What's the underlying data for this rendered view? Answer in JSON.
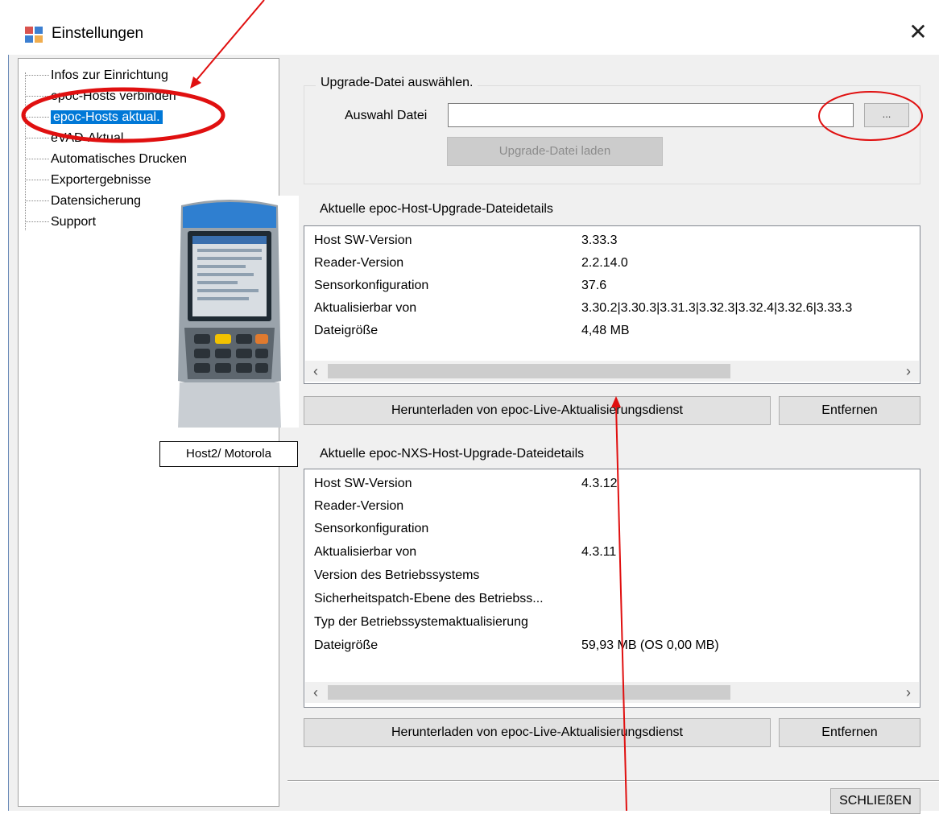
{
  "window": {
    "title": "Einstellungen",
    "close_glyph": "✕"
  },
  "tree": {
    "items": [
      {
        "label": "Infos zur Einrichtung"
      },
      {
        "label": "epoc-Hosts verbinden"
      },
      {
        "label": "epoc-Hosts aktual.",
        "selected": true
      },
      {
        "label": "eVAD-Aktual."
      },
      {
        "label": "Automatisches Drucken"
      },
      {
        "label": "Exportergebnisse"
      },
      {
        "label": "Datensicherung"
      },
      {
        "label": "Support"
      }
    ]
  },
  "upgrade": {
    "group_label": "Upgrade-Datei auswählen.",
    "file_label": "Auswahl Datei",
    "file_value": "",
    "browse_label": "...",
    "load_label": "Upgrade-Datei laden"
  },
  "host_details": {
    "label": "Aktuelle epoc-Host-Upgrade-Dateidetails",
    "rows": [
      {
        "key": "Host SW-Version",
        "value": "3.33.3"
      },
      {
        "key": "Reader-Version",
        "value": "2.2.14.0"
      },
      {
        "key": "Sensorkonfiguration",
        "value": "37.6"
      },
      {
        "key": "Aktualisierbar von",
        "value": "3.30.2|3.30.3|3.31.3|3.32.3|3.32.4|3.32.6|3.33.3"
      },
      {
        "key": "Dateigröße",
        "value": "4,48 MB"
      }
    ],
    "download_label": "Herunterladen von epoc-Live-Aktualisierungsdienst",
    "remove_label": "Entfernen"
  },
  "nxs_details": {
    "label": "Aktuelle epoc-NXS-Host-Upgrade-Dateidetails",
    "rows": [
      {
        "key": "Host SW-Version",
        "value": "4.3.12"
      },
      {
        "key": "Reader-Version",
        "value": ""
      },
      {
        "key": "Sensorkonfiguration",
        "value": ""
      },
      {
        "key": "Aktualisierbar von",
        "value": "4.3.11"
      },
      {
        "key": "Version des Betriebssystems",
        "value": ""
      },
      {
        "key": "Sicherheitspatch-Ebene des Betriebss...",
        "value": ""
      },
      {
        "key": "Typ der Betriebssystemaktualisierung",
        "value": ""
      },
      {
        "key": "Dateigröße",
        "value": "59,93 MB (OS 0,00 MB)"
      }
    ],
    "download_label": "Herunterladen von epoc-Live-Aktualisierungsdienst",
    "remove_label": "Entfernen"
  },
  "scroll": {
    "left": "‹",
    "right": "›"
  },
  "footer": {
    "close_label": "SCHLIEßEN"
  },
  "overlay": {
    "device_caption": "Host2/ Motorola"
  },
  "colors": {
    "selection": "#0078d7",
    "annotation": "#e01010"
  }
}
